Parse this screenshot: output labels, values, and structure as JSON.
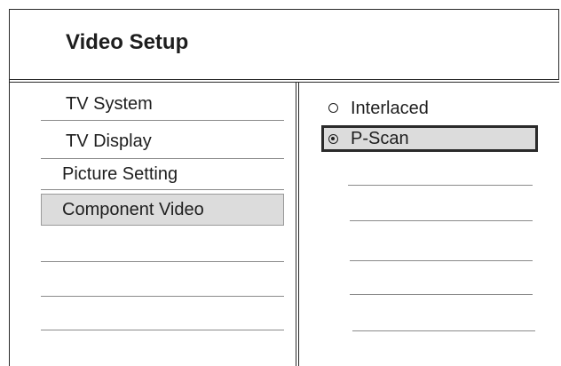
{
  "header": {
    "title": "Video Setup"
  },
  "menu": {
    "items": [
      {
        "label": "TV System"
      },
      {
        "label": "TV Display"
      },
      {
        "label": "Picture Setting"
      },
      {
        "label": "Component Video",
        "selected": true
      }
    ]
  },
  "options": {
    "items": [
      {
        "label": "Interlaced",
        "checked": false
      },
      {
        "label": "P-Scan",
        "checked": true,
        "highlighted": true
      }
    ]
  }
}
